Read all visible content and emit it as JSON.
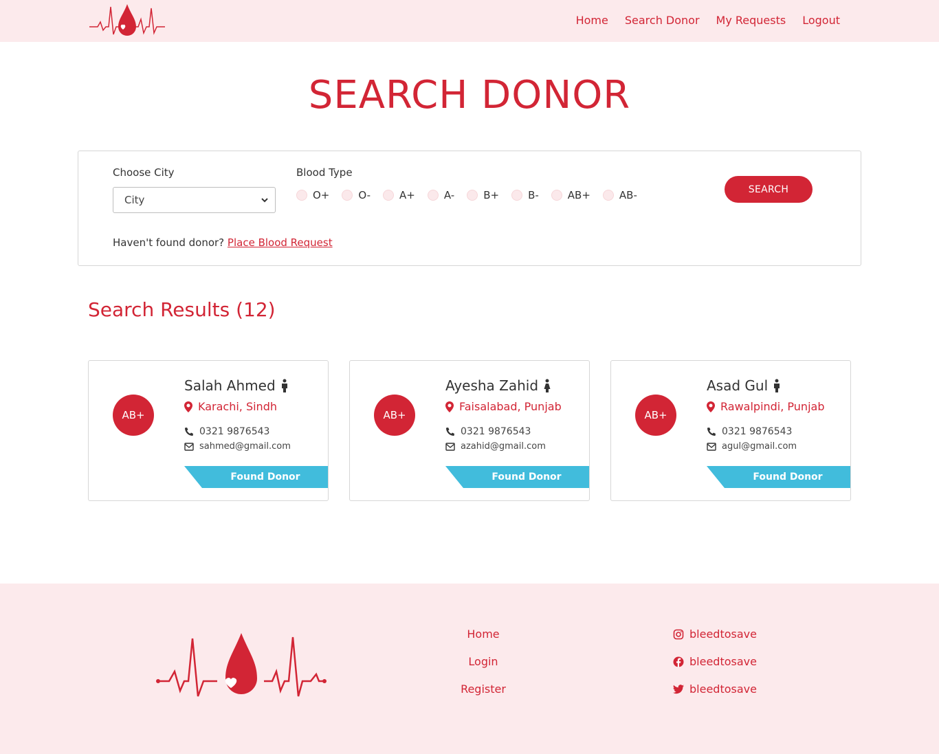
{
  "nav": {
    "items": [
      "Home",
      "Search Donor",
      "My Requests",
      "Logout"
    ]
  },
  "page_title": "SEARCH DONOR",
  "search": {
    "city_label": "Choose City",
    "city_selected": "City",
    "blood_type_label": "Blood Type",
    "blood_types": [
      "O+",
      "O-",
      "A+",
      "A-",
      "B+",
      "B-",
      "AB+",
      "AB-"
    ],
    "search_button": "SEARCH",
    "not_found_text": "Haven't found donor?",
    "place_request_link": "Place Blood Request"
  },
  "results": {
    "heading": "Search Results (12)",
    "cards": [
      {
        "blood": "AB+",
        "name": "Salah Ahmed",
        "location": "Karachi, Sindh",
        "phone": "0321 9876543",
        "email": "sahmed@gmail.com",
        "status": "Found Donor",
        "gender_icon": "male-icon"
      },
      {
        "blood": "AB+",
        "name": "Ayesha Zahid",
        "location": "Faisalabad, Punjab",
        "phone": "0321 9876543",
        "email": "azahid@gmail.com",
        "status": "Found Donor",
        "gender_icon": "female-icon"
      },
      {
        "blood": "AB+",
        "name": "Asad Gul",
        "location": "Rawalpindi, Punjab",
        "phone": "0321 9876543",
        "email": "agul@gmail.com",
        "status": "Found Donor",
        "gender_icon": "male-icon"
      }
    ]
  },
  "footer": {
    "links": [
      "Home",
      "Login",
      "Register"
    ],
    "socials": [
      {
        "icon": "instagram-icon",
        "handle": "bleedtosave"
      },
      {
        "icon": "facebook-icon",
        "handle": "bleedtosave"
      },
      {
        "icon": "twitter-icon",
        "handle": "bleedtosave"
      }
    ]
  },
  "colors": {
    "brand_red": "#d22535",
    "header_bg": "#fceaec",
    "ribbon_blue": "#41bcdc"
  }
}
